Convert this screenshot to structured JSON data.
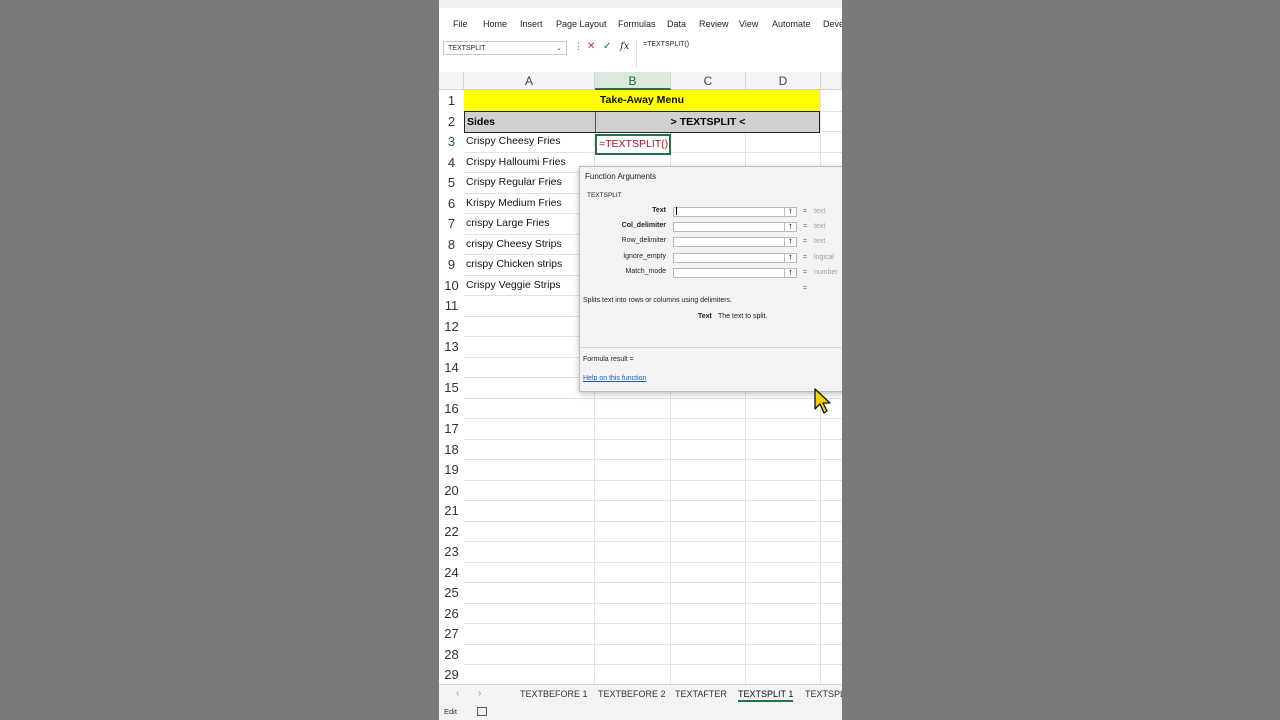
{
  "ribbon": {
    "tabs": [
      "File",
      "Home",
      "Insert",
      "Page Layout",
      "Formulas",
      "Data",
      "Review",
      "View",
      "Automate",
      "Deve"
    ]
  },
  "formula_bar": {
    "name_box": "TEXTSPLIT",
    "formula": "=TEXTSPLIT()"
  },
  "columns": [
    "A",
    "B",
    "C",
    "D"
  ],
  "rows": [
    "1",
    "2",
    "3",
    "4",
    "5",
    "6",
    "7",
    "8",
    "9",
    "10",
    "11",
    "12",
    "13",
    "14",
    "15",
    "16",
    "17",
    "18",
    "19",
    "20",
    "21",
    "22",
    "23",
    "24",
    "25",
    "26",
    "27",
    "28",
    "29"
  ],
  "sheet": {
    "title": "Take-Away Menu",
    "header_sides": "Sides",
    "header_textsplit": "> TEXTSPLIT <",
    "active_cell_content": "=TEXTSPLIT()",
    "sides": [
      "Crispy Cheesy Fries",
      "Crispy Halloumi Fries",
      "Crispy Regular Fries",
      "Krispy Medium Fries",
      "crispy Large Fries",
      "crispy Cheesy Strips",
      "crispy Chicken strips",
      "Crispy Veggie Strips"
    ]
  },
  "dialog": {
    "title": "Function Arguments",
    "function_name": "TEXTSPLIT",
    "args": [
      {
        "name": "Text",
        "type": "text"
      },
      {
        "name": "Col_delimiter",
        "type": "text"
      },
      {
        "name": "Row_delimiter",
        "type": "text"
      },
      {
        "name": "Ignore_empty",
        "type": "logical"
      },
      {
        "name": "Match_mode",
        "type": "number"
      }
    ],
    "eq": "=",
    "description": "Splits text into rows or columns using delimiters.",
    "current_arg": "Text",
    "current_arg_desc": "The text to split.",
    "formula_result": "Formula result =",
    "help_link": "Help on this function"
  },
  "sheet_tabs": [
    "TEXTBEFORE 1",
    "TEXTBEFORE 2",
    "TEXTAFTER",
    "TEXTSPLIT 1",
    "TEXTSPLI"
  ],
  "active_sheet_tab": "TEXTSPLIT 1",
  "status": {
    "mode": "Edit"
  },
  "colors": {
    "excel_green": "#217346",
    "title_fill": "#ffff00",
    "header_fill": "#d0d0d0",
    "formula_text": "#b0121f",
    "link": "#1a5fb4"
  }
}
